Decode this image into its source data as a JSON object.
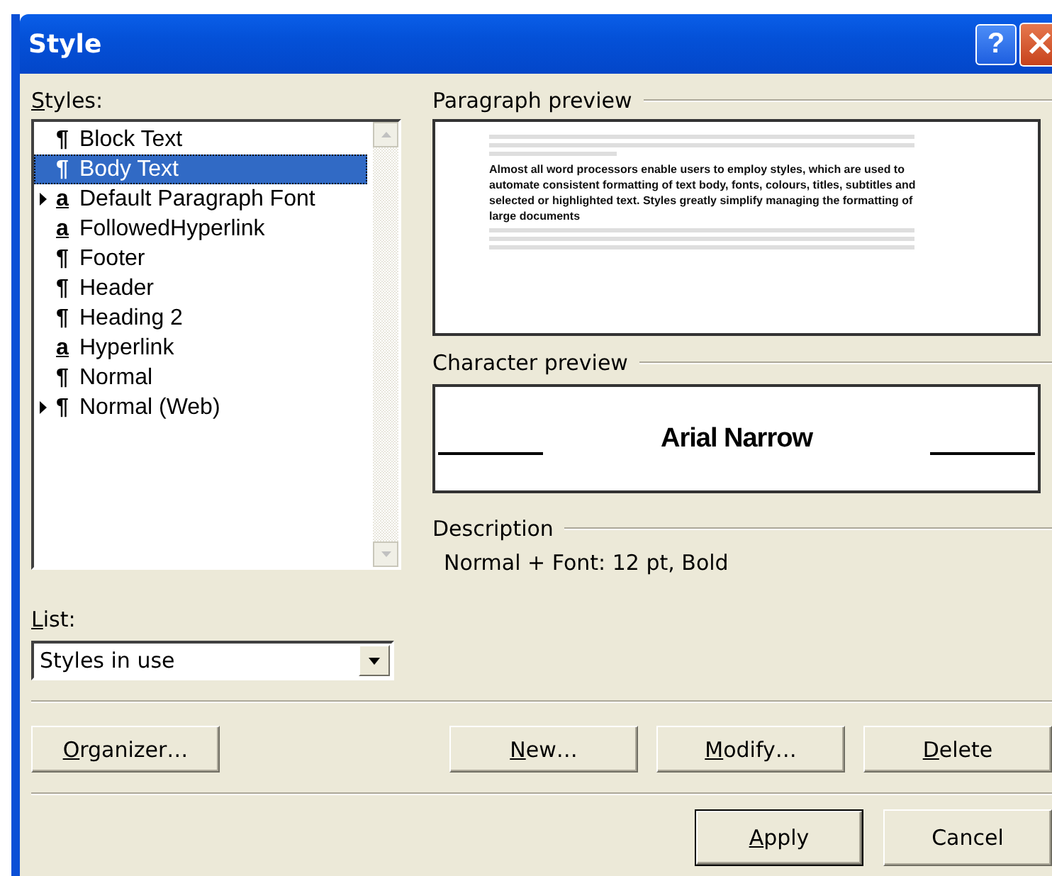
{
  "window": {
    "title": "Style",
    "help_button": "?"
  },
  "styles_label": {
    "text": "Styles:",
    "mnemonic": true
  },
  "styles": [
    {
      "kind": "paragraph",
      "mark": "¶",
      "name": "Block Text",
      "selected": false,
      "indicator": false
    },
    {
      "kind": "paragraph",
      "mark": "¶",
      "name": "Body Text",
      "selected": true,
      "indicator": false
    },
    {
      "kind": "character",
      "mark": "a",
      "name": "Default Paragraph Font",
      "selected": false,
      "indicator": true
    },
    {
      "kind": "character",
      "mark": "a",
      "name": "FollowedHyperlink",
      "selected": false,
      "indicator": false
    },
    {
      "kind": "paragraph",
      "mark": "¶",
      "name": "Footer",
      "selected": false,
      "indicator": false
    },
    {
      "kind": "paragraph",
      "mark": "¶",
      "name": "Header",
      "selected": false,
      "indicator": false
    },
    {
      "kind": "paragraph",
      "mark": "¶",
      "name": "Heading 2",
      "selected": false,
      "indicator": false
    },
    {
      "kind": "character",
      "mark": "a",
      "name": "Hyperlink",
      "selected": false,
      "indicator": false
    },
    {
      "kind": "paragraph",
      "mark": "¶",
      "name": "Normal",
      "selected": false,
      "indicator": false
    },
    {
      "kind": "paragraph",
      "mark": "¶",
      "name": "Normal (Web)",
      "selected": false,
      "indicator": true
    }
  ],
  "list_label": {
    "text": "List:",
    "mnemonic": true
  },
  "list_value": "Styles in use",
  "paragraph_preview": {
    "label": "Paragraph preview",
    "sample": "Almost all word processors enable users to employ styles, which are used to automate consistent formatting of text body, fonts, colours, titles, subtitles and selected or highlighted text. Styles greatly simplify managing the formatting of large documents"
  },
  "character_preview": {
    "label": "Character preview",
    "sample": "Arial Narrow"
  },
  "description": {
    "label": "Description",
    "text": "Normal + Font: 12 pt, Bold"
  },
  "buttons": [
    {
      "label": "Organizer…",
      "mnemonic": true,
      "kind": "left"
    },
    {
      "label": "New…",
      "mnemonic": true,
      "kind": "right"
    },
    {
      "label": "Modify…",
      "mnemonic": true,
      "kind": "right"
    },
    {
      "label": "Delete",
      "mnemonic": true,
      "kind": "right"
    }
  ],
  "footer_buttons": [
    {
      "label": "Apply",
      "mnemonic": true,
      "default": true
    },
    {
      "label": "Cancel",
      "mnemonic": false,
      "default": false
    }
  ]
}
